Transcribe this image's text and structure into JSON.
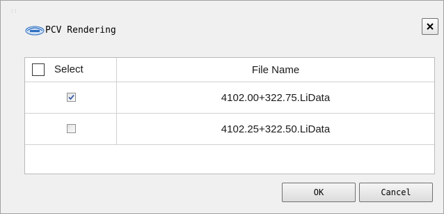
{
  "window": {
    "title": "PCV Rendering",
    "close_icon": "close-icon",
    "logo_icon": "app-logo-icon"
  },
  "table": {
    "columns": [
      "Select",
      "File Name"
    ],
    "rows": [
      {
        "checked": true,
        "file_name": "4102.00+322.75.LiData"
      },
      {
        "checked": false,
        "file_name": "4102.25+322.50.LiData"
      }
    ]
  },
  "buttons": {
    "ok_label": "OK",
    "cancel_label": "Cancel"
  },
  "colors": {
    "dialog_bg": "#f0f0f0",
    "check_accent": "#3b5fa8"
  }
}
